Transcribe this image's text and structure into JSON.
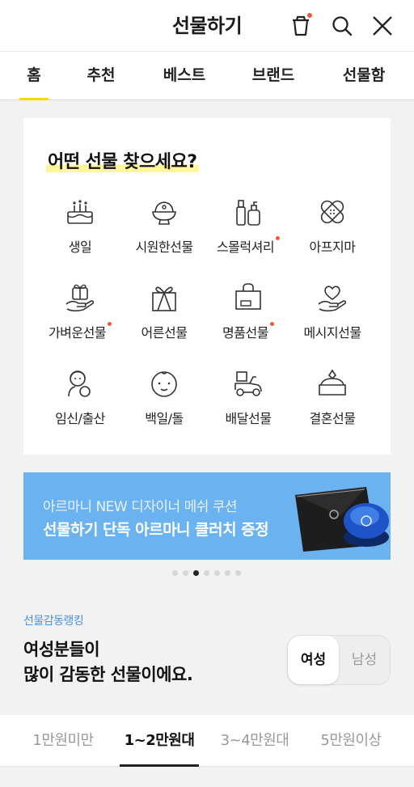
{
  "header": {
    "title": "선물하기",
    "icons": [
      "gift-box-icon",
      "search-icon",
      "close-icon"
    ]
  },
  "tabs": [
    {
      "label": "홈",
      "active": true
    },
    {
      "label": "추천"
    },
    {
      "label": "베스트"
    },
    {
      "label": "브랜드"
    },
    {
      "label": "선물함"
    }
  ],
  "categories": {
    "title": "어떤 선물 찾으세요?",
    "items": [
      {
        "label": "생일",
        "icon": "cake-icon"
      },
      {
        "label": "시원한선물",
        "icon": "bingsu-icon"
      },
      {
        "label": "스몰럭셔리",
        "icon": "cosmetics-icon",
        "new": true
      },
      {
        "label": "아프지마",
        "icon": "bandage-icon"
      },
      {
        "label": "가벼운선물",
        "icon": "gift-in-hand-icon",
        "new": true
      },
      {
        "label": "어른선물",
        "icon": "ribbon-box-icon"
      },
      {
        "label": "명품선물",
        "icon": "shopping-bag-icon",
        "new": true
      },
      {
        "label": "메시지선물",
        "icon": "heart-in-hand-icon"
      },
      {
        "label": "임신/출산",
        "icon": "mother-baby-icon"
      },
      {
        "label": "백일/돌",
        "icon": "baby-face-icon"
      },
      {
        "label": "배달선물",
        "icon": "delivery-scooter-icon"
      },
      {
        "label": "결혼선물",
        "icon": "ring-box-icon"
      }
    ]
  },
  "banner": {
    "line1": "아르마니 NEW 디자이너 메쉬 쿠션",
    "line2": "선물하기 단독 아르마니 클러치 증정",
    "background": "#6ab2f0",
    "page_count": 7,
    "current_page": 3
  },
  "ranking": {
    "eyebrow": "선물감동랭킹",
    "title_line1": "여성분들이",
    "title_line2": "많이 감동한 선물이에요.",
    "gender": {
      "selected": "여성",
      "other": "남성"
    }
  },
  "price_tabs": [
    {
      "label": "1만원미만"
    },
    {
      "label": "1~2만원대",
      "active": true
    },
    {
      "label": "3~4만원대"
    },
    {
      "label": "5만원이상"
    }
  ],
  "colors": {
    "accent_yellow": "#ffd800",
    "notification_dot": "#f2573c",
    "link_blue": "#4a90e2"
  }
}
